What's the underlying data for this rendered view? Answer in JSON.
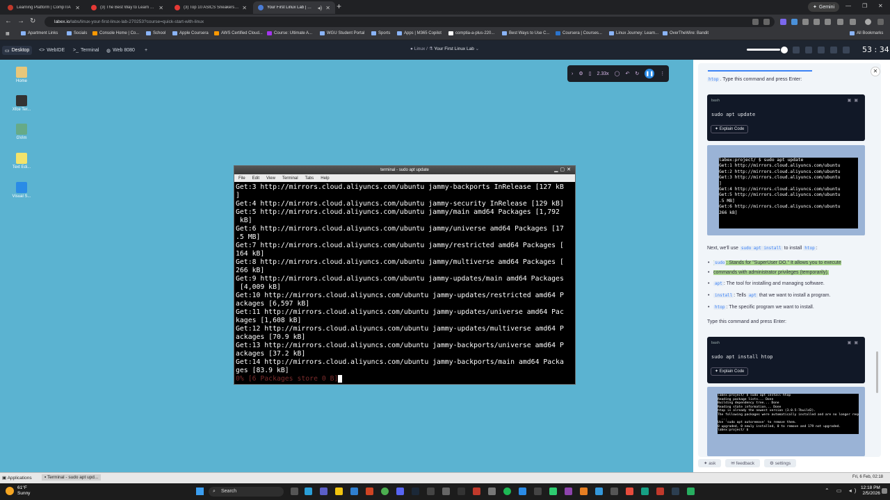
{
  "browser": {
    "tabs": [
      {
        "label": "Learning Platform | CompTIA",
        "color": "#c0392b"
      },
      {
        "label": "(3) The Best Way to Learn Linux",
        "color": "#e53935"
      },
      {
        "label": "(3) Top 10 ASICS Sneakers for 2",
        "color": "#e53935"
      },
      {
        "label": "Your First Linux Lab | Quick",
        "color": "#4a7cd6"
      }
    ],
    "gemini_label": "Gemini",
    "url_host": "labex.io",
    "url_path": "/labs/linux-your-first-linux-lab-270253?course=quick-start-with-linux",
    "bookmarks": [
      "Apartment Links",
      "Socials",
      "Console Home | Co...",
      "School",
      "Apple Coursera",
      "AWS Certified Cloud...",
      "Course: Ultimate A...",
      "WGU Student Portal",
      "Sports",
      "Apps | M365 Copilot",
      "comptia-a-plus-220...",
      "Best Ways to Use C...",
      "Coursera | Courses...",
      "Linux Journey: Learn...",
      "OverTheWire: Bandit"
    ],
    "all_bookmarks": "All Bookmarks"
  },
  "labex": {
    "tabs": [
      "Desktop",
      "WebIDE",
      "Terminal",
      "Web 8080"
    ],
    "breadcrumb_root": "Linux",
    "breadcrumb_sep": "/",
    "breadcrumb_page": "Your First Linux Lab",
    "timer": "53 : 34",
    "speed": "2.33x"
  },
  "desktop_icons": [
    {
      "label": "Home",
      "color": "#e8c77a"
    },
    {
      "label": "Xfce Ter...",
      "color": "#333"
    },
    {
      "label": "GVim",
      "color": "#6a8"
    },
    {
      "label": "Text Edi...",
      "color": "#f3e36b"
    },
    {
      "label": "Visual S...",
      "color": "#2a8be6"
    }
  ],
  "terminal": {
    "title": "terminal - sudo apt update",
    "menu": [
      "File",
      "Edit",
      "View",
      "Terminal",
      "Tabs",
      "Help"
    ],
    "lines": [
      "Get:3 http://mirrors.cloud.aliyuncs.com/ubuntu jammy-backports InRelease [127 kB",
      "]",
      "Get:4 http://mirrors.cloud.aliyuncs.com/ubuntu jammy-security InRelease [129 kB]",
      "Get:5 http://mirrors.cloud.aliyuncs.com/ubuntu jammy/main amd64 Packages [1,792",
      " kB]",
      "Get:6 http://mirrors.cloud.aliyuncs.com/ubuntu jammy/universe amd64 Packages [17",
      ".5 MB]",
      "Get:7 http://mirrors.cloud.aliyuncs.com/ubuntu jammy/restricted amd64 Packages [",
      "164 kB]",
      "Get:8 http://mirrors.cloud.aliyuncs.com/ubuntu jammy/multiverse amd64 Packages [",
      "266 kB]",
      "Get:9 http://mirrors.cloud.aliyuncs.com/ubuntu jammy-updates/main amd64 Packages",
      " [4,009 kB]",
      "Get:10 http://mirrors.cloud.aliyuncs.com/ubuntu jammy-updates/restricted amd64 P",
      "ackages [6,597 kB]",
      "Get:11 http://mirrors.cloud.aliyuncs.com/ubuntu jammy-updates/universe amd64 Pac",
      "kages [1,608 kB]",
      "Get:12 http://mirrors.cloud.aliyuncs.com/ubuntu jammy-updates/multiverse amd64 P",
      "ackages [70.9 kB]",
      "Get:13 http://mirrors.cloud.aliyuncs.com/ubuntu jammy-backports/universe amd64 P",
      "ackages [37.2 kB]",
      "Get:14 http://mirrors.cloud.aliyuncs.com/ubuntu jammy-backports/main amd64 Packa",
      "ges [83.9 kB]"
    ],
    "status_line": "0% [6 Packages store 0 B]"
  },
  "panel": {
    "intro_code": "htop",
    "intro_text": ". Type this command and press Enter:",
    "block1_lang": "bash",
    "block1_cmd": "sudo apt update",
    "explain_label": "Explain Code",
    "shot1_title": "terminal - labex@labex-0...",
    "shot1_lines": [
      "labex:project/ $ sudo apt update",
      "Get:1 http://mirrors.cloud.aliyuncs.com/ubuntu",
      "Get:2 http://mirrors.cloud.aliyuncs.com/ubuntu",
      "Get:3 http://mirrors.cloud.aliyuncs.com/ubuntu",
      "]",
      "Get:4 http://mirrors.cloud.aliyuncs.com/ubuntu",
      "Get:5 http://mirrors.cloud.aliyuncs.com/ubuntu",
      ".5 MB]",
      "Get:6 http://mirrors.cloud.aliyuncs.com/ubuntu",
      "266 kB]"
    ],
    "next_pre": "Next, we'll use",
    "next_code": "sudo apt install",
    "next_mid": "to install",
    "next_code2": "htop",
    "bullets": [
      {
        "code": "sudo",
        "text": ": Stands for \"SuperUser DO.\" It allows you to execute",
        "text2": "commands with administrator privileges (temporarily)."
      },
      {
        "code": "apt",
        "text": ": The tool for installing and managing software."
      },
      {
        "code": "install",
        "text": ": Tells",
        "code2": "apt",
        "text3": "that we want to install a program."
      },
      {
        "code": "htop",
        "text": ": The specific program we want to install."
      }
    ],
    "type_prompt": "Type this command and press Enter:",
    "block2_lang": "bash",
    "block2_cmd": "sudo apt install htop",
    "shot2_lines": [
      "labex:project/ $ sudo apt install htop",
      "Reading package lists... Done",
      "Building dependency tree... Done",
      "Reading state information... Done",
      "htop is already the newest version (3.0.5-7build2).",
      "The following packages were automatically installed and are no longer requ",
      "  ...",
      "Use 'sudo apt autoremove' to remove them.",
      "0 upgraded, 0 newly installed, 0 to remove and 179 not upgraded.",
      "labex:project/ $"
    ],
    "footer": [
      "ask",
      "feedback",
      "settings"
    ]
  },
  "xfce": {
    "applications": "Applications",
    "task": "Terminal - sudo apt upd...",
    "clock": "Fri, 6 Feb, 02:18"
  },
  "taskbar": {
    "weather_temp": "61°F",
    "weather_desc": "Sunny",
    "search_placeholder": "Search",
    "time": "12:18 PM",
    "date": "2/5/2026"
  }
}
